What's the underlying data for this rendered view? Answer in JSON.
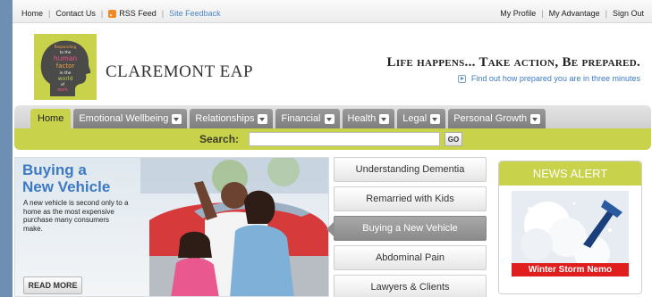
{
  "topbar": {
    "links_left": [
      "Home",
      "Contact Us",
      "RSS Feed",
      "Site Feedback"
    ],
    "links_right": [
      "My Profile",
      "My Advantage",
      "Sign Out"
    ]
  },
  "header": {
    "logo_text": [
      "Responding",
      "to the",
      "human",
      "factor",
      "in the",
      "world",
      "of",
      "work"
    ],
    "brand": "CLAREMONT EAP",
    "tagline": "Life happens... Take action, Be prepared.",
    "cta": "Find out how prepared you are in three minutes"
  },
  "nav": {
    "tabs": [
      {
        "label": "Home",
        "dropdown": false,
        "active": true
      },
      {
        "label": "Emotional Wellbeing",
        "dropdown": true
      },
      {
        "label": "Relationships",
        "dropdown": true
      },
      {
        "label": "Financial",
        "dropdown": true
      },
      {
        "label": "Health",
        "dropdown": true
      },
      {
        "label": "Legal",
        "dropdown": true
      },
      {
        "label": "Personal Growth",
        "dropdown": true
      }
    ]
  },
  "search": {
    "label": "Search:",
    "value": "",
    "button": "GO"
  },
  "feature": {
    "title_line1": "Buying a",
    "title_line2": "New Vehicle",
    "description": "A new vehicle is second only to a home as the most expensive purchase many consumers make.",
    "read_more": "READ MORE"
  },
  "topics": [
    "Understanding Dementia",
    "Remarried with Kids",
    "Buying a New Vehicle",
    "Abdominal Pain",
    "Lawyers & Clients"
  ],
  "active_topic": "Buying a New Vehicle",
  "news": {
    "header": "NEWS ALERT",
    "caption": "Winter Storm Nemo"
  },
  "colors": {
    "accent_green": "#c8d24a",
    "link_blue": "#3d79c2",
    "alert_red": "#e11e1e"
  }
}
